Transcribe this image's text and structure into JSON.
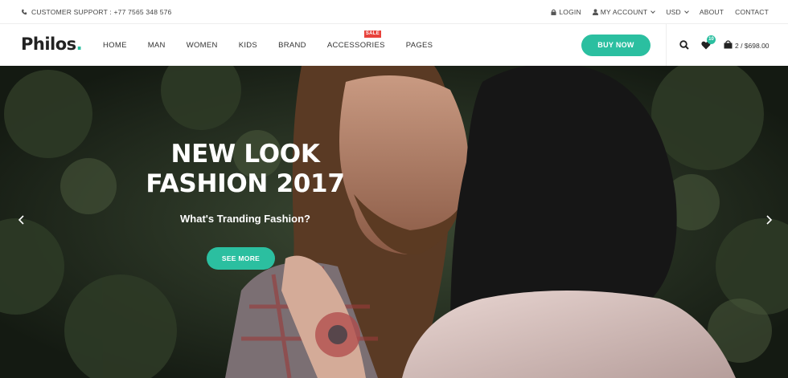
{
  "topbar": {
    "support": "CUSTOMER SUPPORT : +77 7565 348 576",
    "login": "LOGIN",
    "account": "MY ACCOUNT",
    "currency": "USD",
    "about": "ABOUT",
    "contact": "CONTACT"
  },
  "header": {
    "logo": "Philos",
    "logo_dot": ".",
    "nav": [
      "HOME",
      "MAN",
      "WOMEN",
      "KIDS",
      "BRAND",
      "ACCESSORIES",
      "PAGES"
    ],
    "sale_badge": "SALE",
    "buy_now": "BUY NOW",
    "wishlist_count": "10",
    "cart": "2 / $698.00"
  },
  "hero": {
    "headline_line1": "NEW LOOK",
    "headline_line2": "FASHION 2017",
    "subtitle": "What's Tranding Fashion?",
    "cta": "SEE MORE"
  },
  "colors": {
    "accent": "#2bbfa0",
    "sale": "#e8423b"
  },
  "icons": [
    "phone-icon",
    "lock-icon",
    "user-icon",
    "search-icon",
    "heart-icon",
    "shopping-bag-icon",
    "chevron-left-icon",
    "chevron-right-icon"
  ]
}
